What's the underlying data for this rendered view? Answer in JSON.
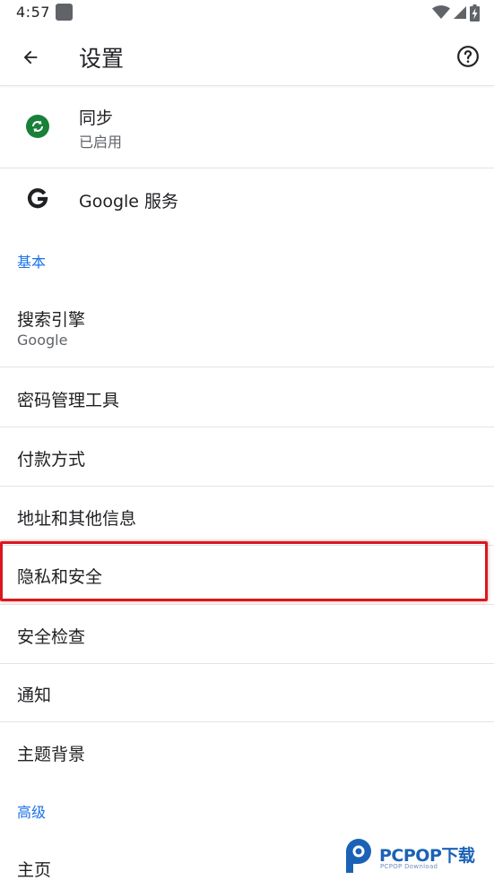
{
  "status_bar": {
    "time": "4:57",
    "icons": [
      "notification-square-icon",
      "wifi-icon",
      "cell-signal-icon",
      "battery-charging-icon"
    ]
  },
  "app_bar": {
    "title": "设置",
    "back_icon": "arrow-left-icon",
    "help_icon": "help-circle-icon"
  },
  "account": {
    "sync": {
      "title": "同步",
      "subtitle": "已启用",
      "icon": "sync-icon",
      "icon_color": "#188038"
    },
    "google_services": {
      "title": "Google 服务",
      "icon": "google-g-icon"
    }
  },
  "basic": {
    "header": "基本",
    "items": [
      {
        "title": "搜索引擎",
        "subtitle": "Google"
      },
      {
        "title": "密码管理工具"
      },
      {
        "title": "付款方式"
      },
      {
        "title": "地址和其他信息"
      },
      {
        "title": "隐私和安全",
        "highlighted": true
      },
      {
        "title": "安全检查"
      },
      {
        "title": "通知"
      },
      {
        "title": "主题背景"
      }
    ]
  },
  "advanced": {
    "header": "高级",
    "items": [
      {
        "title": "主页"
      }
    ]
  },
  "watermark": {
    "text": "PCPOP下载",
    "subtext": "PCPOP Download"
  },
  "colors": {
    "accent": "#1a73e8",
    "highlight": "#d9181e",
    "divider": "#e3e3e3",
    "secondary_text": "#5f6368"
  }
}
